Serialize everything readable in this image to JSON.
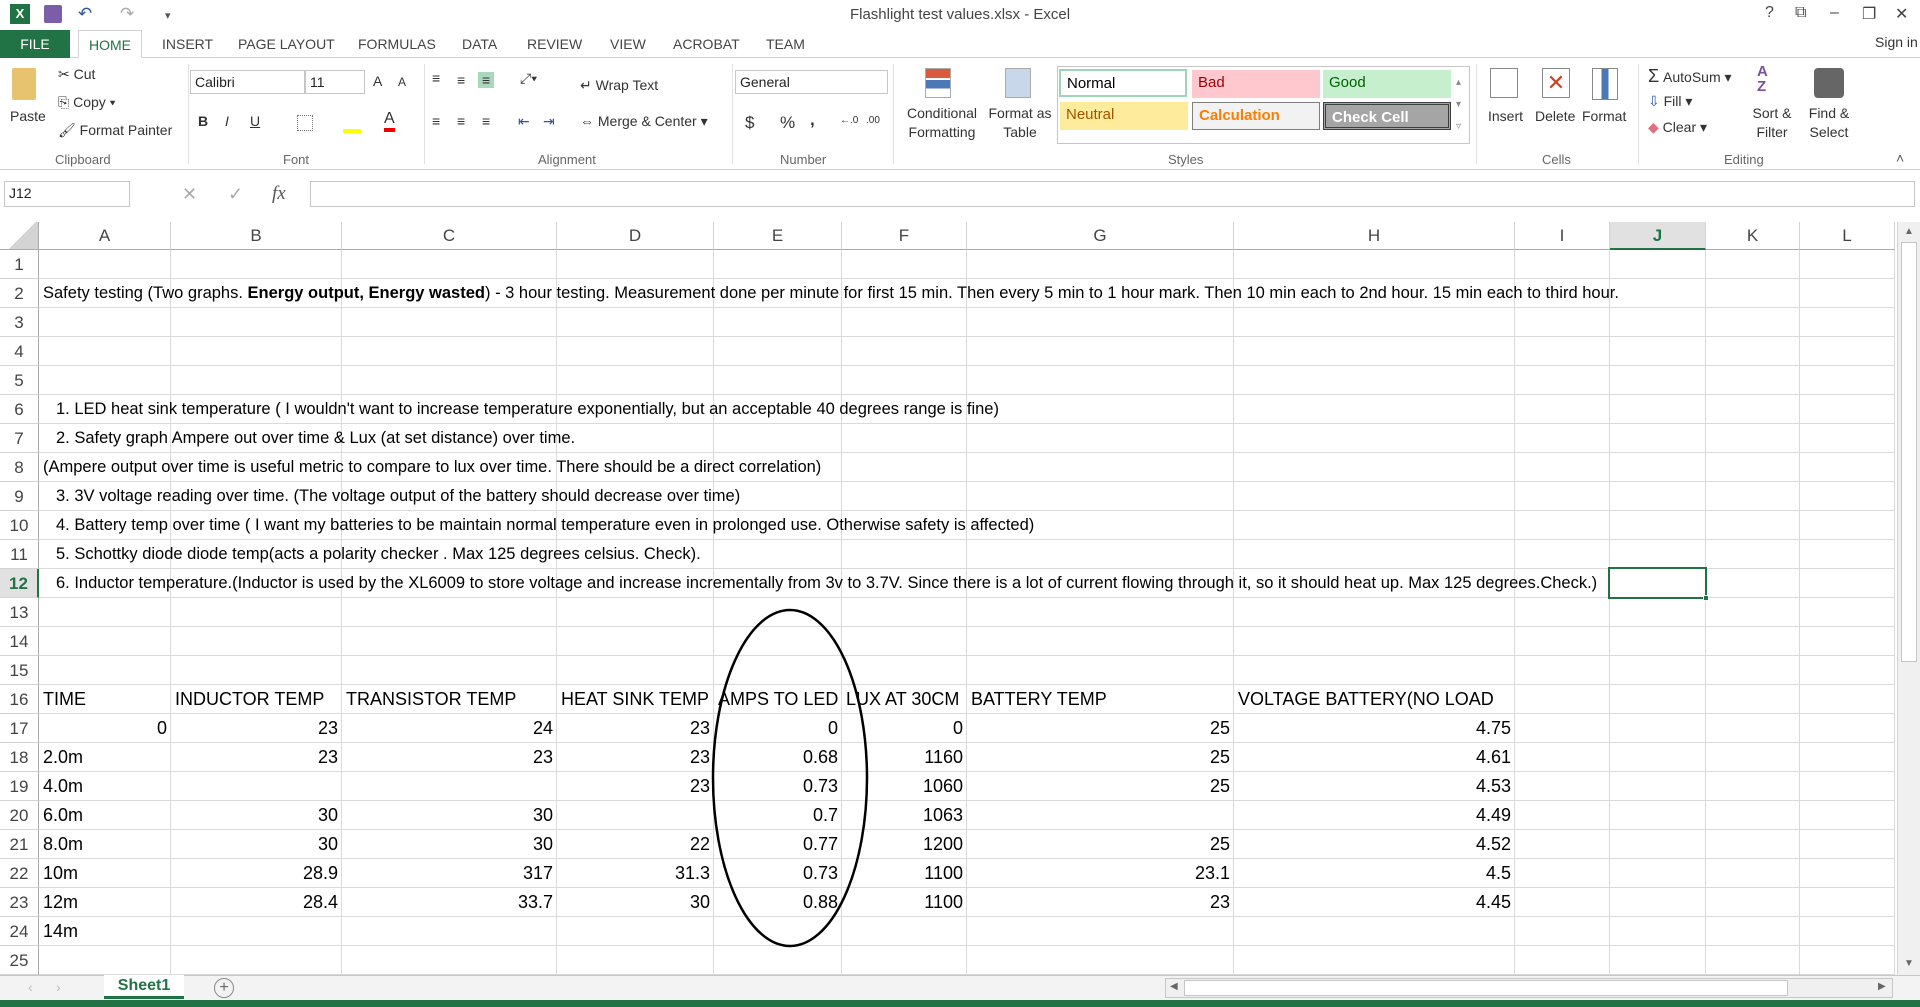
{
  "window": {
    "title": "Flashlight test values.xlsx - Excel",
    "help": "?",
    "restore_ribbon": "⧉",
    "minimize": "–",
    "maximize": "❐",
    "close": "✕",
    "sign_in": "Sign in"
  },
  "quick_access": {
    "undo": "↶",
    "redo": "↷",
    "save": "💾",
    "customize": "▾",
    "app_icon": "X"
  },
  "tabs": [
    "FILE",
    "HOME",
    "INSERT",
    "PAGE LAYOUT",
    "FORMULAS",
    "DATA",
    "REVIEW",
    "VIEW",
    "ACROBAT",
    "TEAM"
  ],
  "ribbon": {
    "clipboard": {
      "paste": "Paste",
      "cut": "Cut",
      "copy": "Copy",
      "format_painter": "Format Painter",
      "group": "Clipboard"
    },
    "font": {
      "name": "Calibri",
      "size": "11",
      "bold": "B",
      "italic": "I",
      "underline": "U",
      "group": "Font",
      "grow": "A",
      "shrink": "A",
      "color": "A"
    },
    "alignment": {
      "wrap": "Wrap Text",
      "merge": "Merge & Center",
      "group": "Alignment"
    },
    "number": {
      "format": "General",
      "currency": "$",
      "percent": "%",
      "comma": ",",
      "inc": "←.0",
      "dec": ".00",
      "group": "Number"
    },
    "styles": {
      "conditional": "Conditional Formatting",
      "format_table": "Format as Table",
      "normal": "Normal",
      "bad": "Bad",
      "good": "Good",
      "neutral": "Neutral",
      "calculation": "Calculation",
      "check_cell": "Check Cell",
      "group": "Styles"
    },
    "cells": {
      "insert": "Insert",
      "delete": "Delete",
      "format": "Format",
      "group": "Cells"
    },
    "editing": {
      "autosum": "AutoSum",
      "fill": "Fill",
      "clear": "Clear",
      "sort": "Sort & Filter",
      "find": "Find & Select",
      "group": "Editing"
    }
  },
  "formula_bar": {
    "name_box": "J12",
    "cancel": "✕",
    "enter": "✓",
    "fx": "fx",
    "value": ""
  },
  "columns": [
    "A",
    "B",
    "C",
    "D",
    "E",
    "F",
    "G",
    "H",
    "I",
    "J",
    "K",
    "L"
  ],
  "selected_cell": {
    "column": "J",
    "row": 12
  },
  "notes": [
    {
      "row": 2,
      "indent": false,
      "segments": [
        {
          "t": "Safety testing (Two graphs. ",
          "b": false
        },
        {
          "t": "Energy output, Energy wasted",
          "b": true
        },
        {
          "t": ") - 3 hour testing. Measurement done per minute for first 15 min. Then every 5 min to 1 hour mark. Then 10 min each to 2nd hour. 15 min each to third hour.",
          "b": false
        }
      ]
    },
    {
      "row": 6,
      "indent": true,
      "segments": [
        {
          "t": "1. LED heat sink temperature ( I wouldn't want to increase temperature exponentially, but an acceptable 40 degrees range is fine)",
          "b": false
        }
      ]
    },
    {
      "row": 7,
      "indent": true,
      "segments": [
        {
          "t": "2. Safety graph  Ampere out over time &  Lux  (at set distance) over time.",
          "b": false
        }
      ]
    },
    {
      "row": 8,
      "indent": false,
      "segments": [
        {
          "t": "(Ampere output over time is useful metric to compare to lux over time. There should be a direct correlation)",
          "b": false
        }
      ]
    },
    {
      "row": 9,
      "indent": true,
      "segments": [
        {
          "t": "3. 3V voltage reading over time. (The voltage output of the battery should decrease over time)",
          "b": false
        }
      ]
    },
    {
      "row": 10,
      "indent": true,
      "segments": [
        {
          "t": "4. Battery temp over time ( I want my batteries to be maintain normal temperature even in prolonged use. Otherwise safety is affected)",
          "b": false
        }
      ]
    },
    {
      "row": 11,
      "indent": true,
      "segments": [
        {
          "t": "5. Schottky diode diode temp(acts a polarity checker . Max 125 degrees celsius. Check).",
          "b": false
        }
      ]
    },
    {
      "row": 12,
      "indent": true,
      "segments": [
        {
          "t": "6. Inductor temperature.(Inductor is used by the XL6009 to store voltage and increase incrementally from 3v to 3.7V. Since there is a lot of current flowing through it, so it should heat up. Max 125 degrees.Check.)",
          "b": false
        }
      ]
    }
  ],
  "table": {
    "header_row": 16,
    "headers": [
      "TIME",
      "INDUCTOR TEMP",
      "TRANSISTOR TEMP",
      "HEAT SINK TEMP",
      "AMPS TO LED",
      "LUX AT 30CM",
      "BATTERY TEMP",
      "VOLTAGE BATTERY(NO LOAD"
    ],
    "rows": [
      {
        "row": 17,
        "cells": [
          "0",
          "23",
          "24",
          "23",
          "0",
          "0",
          "25",
          "4.75"
        ]
      },
      {
        "row": 18,
        "cells": [
          "2.0m",
          "23",
          "23",
          "23",
          "0.68",
          "1160",
          "25",
          "4.61"
        ]
      },
      {
        "row": 19,
        "cells": [
          "4.0m",
          "",
          "",
          "23",
          "0.73",
          "1060",
          "25",
          "4.53"
        ]
      },
      {
        "row": 20,
        "cells": [
          "6.0m",
          "30",
          "30",
          "",
          "0.7",
          "1063",
          "",
          "4.49"
        ]
      },
      {
        "row": 21,
        "cells": [
          "8.0m",
          "30",
          "30",
          "22",
          "0.77",
          "1200",
          "25",
          "4.52"
        ]
      },
      {
        "row": 22,
        "cells": [
          "10m",
          "28.9",
          "317",
          "31.3",
          "0.73",
          "1100",
          "23.1",
          "4.5"
        ]
      },
      {
        "row": 23,
        "cells": [
          "12m",
          "28.4",
          "33.7",
          "30",
          "0.88",
          "1100",
          "23",
          "4.45"
        ]
      },
      {
        "row": 24,
        "cells": [
          "14m",
          "",
          "",
          "",
          "",
          "",
          "",
          ""
        ]
      }
    ]
  },
  "sheets": [
    {
      "name": "Sheet1",
      "active": true
    }
  ],
  "colors": {
    "accent": "#217346",
    "bad_bg": "#ffc7ce",
    "good_bg": "#c6efce",
    "neutral_bg": "#ffeb9c",
    "check_bg": "#a5a5a5"
  }
}
